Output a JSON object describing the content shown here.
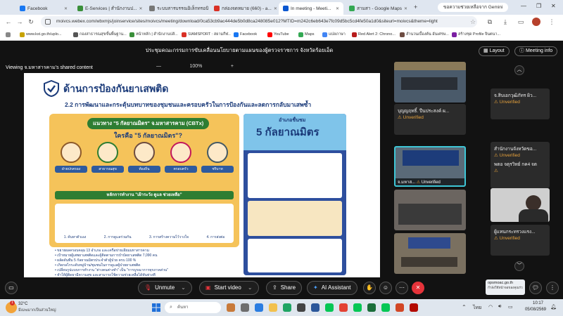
{
  "browser": {
    "tabs": [
      {
        "label": "Facebook",
        "color": "#1877f2"
      },
      {
        "label": "E-Services | สำนักงานป...",
        "color": "#3a8f3a"
      },
      {
        "label": "ระบบสารบรรณอิเล็กทรอนิ...",
        "color": "#666666"
      },
      {
        "label": "กล่องจดหมาย (660) - a...",
        "color": "#d93025"
      },
      {
        "label": "In meeting - Meeti...",
        "color": "#0b57d0"
      },
      {
        "label": "สามสา - Google Maps",
        "color": "#34a853"
      }
    ],
    "gemini_label": "ขอความช่วยเหลือจาก Gemini",
    "url": "moivcs.webex.com/wbxmjs/joinservice/sites/moivcs/meeting/download/0ca53cb9ac444de5b0d8ca248085e012?MTID=m242c6eb643e7fc09d5bc5cd4fe50a1d0&siteurl=moivcs&theme=light",
    "bookmarks": [
      "www.kst.go.th/uplo...",
      "กองสาธารณสุขขั้นพื้นฐาน...",
      "หน้าหลัก | สำนักงานปลั...",
      "SIAMSPORT : สยามกีฬ...",
      "Facebook",
      "YouTube",
      "Maps",
      "แปลภาษา",
      "Red Alert 2: Chrono...",
      "สำนวนเบื้องต้น อันเศรษ...",
      "สร้างชุด Profile จินตนา..."
    ]
  },
  "meeting": {
    "title": "ประชุมคณะกรรมการขับเคลื่อนนโยบายตามแผนของผู้ตรวจราชการ จังหวัดร้อยเอ็ด",
    "layout_label": "Layout",
    "info_label": "Meeting info",
    "viewing_label": "Viewing จ.มหาสารคาม's shared content",
    "zoom_minus": "—",
    "zoom_value": "100%",
    "zoom_plus": "+",
    "slide": {
      "title": "ด้านการป้องกันยาเสพติด",
      "subtitle": "2.2 การพัฒนาและกระตุ้นบทบาทของชุมชนและครอบครัวในการป้องกันและลดการกลับมาเสพซ้ำ",
      "left_heading": "แนวทาง \"5 กัลยาณมิตร\" จ.มหาสารคาม (CBTx)",
      "left_question": "ใครคือ \"5 กัลยาณมิตร\"?",
      "roles": [
        "ฝ่ายปกครอง",
        "สาธารณสุข",
        "ท้องถิ่น",
        "ครอบครัว",
        "ชริบาท"
      ],
      "principles": "หลักการทำงาน \"เฝ้าระวัง ดูแล ช่วยเหลือ\"",
      "steps": [
        "1. ค้นหาตัวเอง",
        "2. การดูแลร่วมกัน",
        "3. การสร้างความไว้วางใจ",
        "4. การส่งต่อ"
      ],
      "right_title": "อำเภอชื่นชม",
      "right_big": "5 กัลยาณมิตร",
      "bullets": [
        "ขยายผลครอบคลุม 13 อำเภอ และเครือข่ายเอียมมหาสารคาม",
        "เป้าหมายผู้เสพยาเสพติดและผู้ติดตามการบำบัดยาเสพติด 7,090 คน",
        "ผลัดดันทีม 5 กัลยาณมิตรประจำตัวผู้ป่วย ครบ 100 %",
        "เกิดกลไกระดับหมู่บ้าน/ชุมชนในการดูแลผู้ป่วยยาเสพติด",
        "เปลี่ยนรูปแบบการทำงาน \"ต่างคนต่างทำ\" เป็น \"การบูรณาการทุกภาคส่วน\"",
        "ทำให้ผู้ติดยามีความสุข และสามารถใช้ความช่วยเหลือได้ทันท่วงที"
      ]
    },
    "participants": [
      {
        "name": "จ.สิบเอกวุฒิภัทร ผิว...",
        "status": "Unverified"
      },
      {
        "name": "บุญญฤทธิ์. ปืนประสงค์ ผ...",
        "status": "Unverified"
      },
      {
        "name": "สำนักงานจังหวัดขอ...",
        "status": "Unverified"
      },
      {
        "name": "จ.มหาส...",
        "status": "Unverified"
      },
      {
        "name": "พตอ จตุรวิทย์ กค4 จต",
        "status": "Unverified"
      },
      {
        "name": "ผู้แทนกระทรวงแรง...",
        "status": "Unverified"
      }
    ],
    "controls": {
      "unmute": "Unmute",
      "start_video": "Start video",
      "share": "Share",
      "ai_assistant": "AI Assistant"
    },
    "toast": {
      "line1": "opsmoac.go.th",
      "line2": "กำลังใช้หน้าจอของคุณร่วมกับ"
    }
  },
  "taskbar": {
    "weather_temp": "32°C",
    "weather_desc": "มีเมฆมากเป็นส่วนใหญ่",
    "search_placeholder": "ค้นหา",
    "lang": "ไทย",
    "time": "10:17",
    "date": "05/08/2569"
  },
  "colors": {
    "webex_dark": "#121212",
    "unmute_red": "#e5333a",
    "unverified": "#e8a33c",
    "accent_blue": "#1b3b7a"
  }
}
